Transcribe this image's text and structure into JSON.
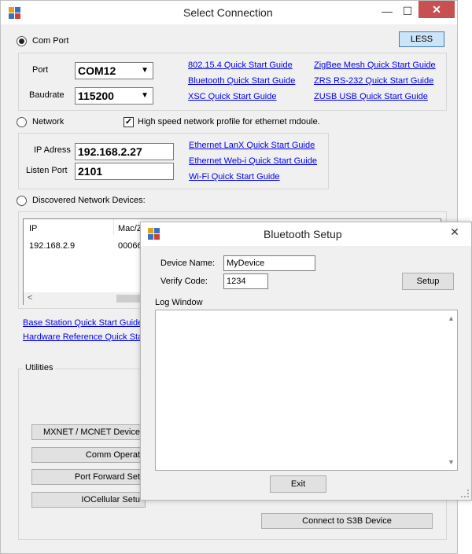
{
  "main": {
    "title": "Select Connection",
    "window_controls": {
      "minimize": "—",
      "maximize": "☐",
      "close": "✕"
    },
    "less_button": "LESS",
    "com_port": {
      "radio_label": "Com Port",
      "port_label": "Port",
      "port_value": "COM12",
      "baud_label": "Baudrate",
      "baud_value": "115200"
    },
    "guides_col1": [
      "802.15.4 Quick Start Guide",
      "Bluetooth Quick Start Guide",
      "XSC Quick Start Guide"
    ],
    "guides_col2": [
      "ZigBee Mesh Quick Start Guide",
      "ZRS RS-232 Quick Start Guide",
      "ZUSB USB Quick Start Guide"
    ],
    "network": {
      "radio_label": "Network",
      "checkbox_label": "High speed network profile for ethernet mdoule.",
      "checkbox_mark": "✓",
      "ip_label": "IP Adress",
      "ip_value": "192.168.2.27",
      "port_label": "Listen Port",
      "port_value": "2101",
      "guides": [
        "Ethernet LanX Quick Start Guide",
        "Ethernet Web-i Quick Start Guide",
        "Wi-Fi Quick Start Guide"
      ]
    },
    "discovered": {
      "radio_label": "Discovered Network Devices:",
      "columns": [
        "IP",
        "Mac/Z"
      ],
      "rows": [
        [
          "192.168.2.9",
          "00066"
        ]
      ],
      "scroll_left": "<"
    },
    "bottom_links": [
      "Base Station Quick Start Guide",
      "Hardware Reference Quick Star"
    ],
    "utilities_label": "Utilities",
    "utility_buttons": [
      "MXNET / MCNET Device",
      "Comm Operat",
      "Port Forward Set",
      "IOCellular Setu"
    ],
    "right_buttons": [
      "Connect to S3B Device"
    ]
  },
  "dialog": {
    "title": "Bluetooth Setup",
    "close": "✕",
    "device_name_label": "Device Name:",
    "device_name_value": "MyDevice",
    "verify_code_label": "Verify Code:",
    "verify_code_value": "1234",
    "setup_button": "Setup",
    "log_label": "Log Window",
    "log_text": "",
    "scroll_up": "▲",
    "scroll_down": "▼",
    "exit_button": "Exit"
  }
}
